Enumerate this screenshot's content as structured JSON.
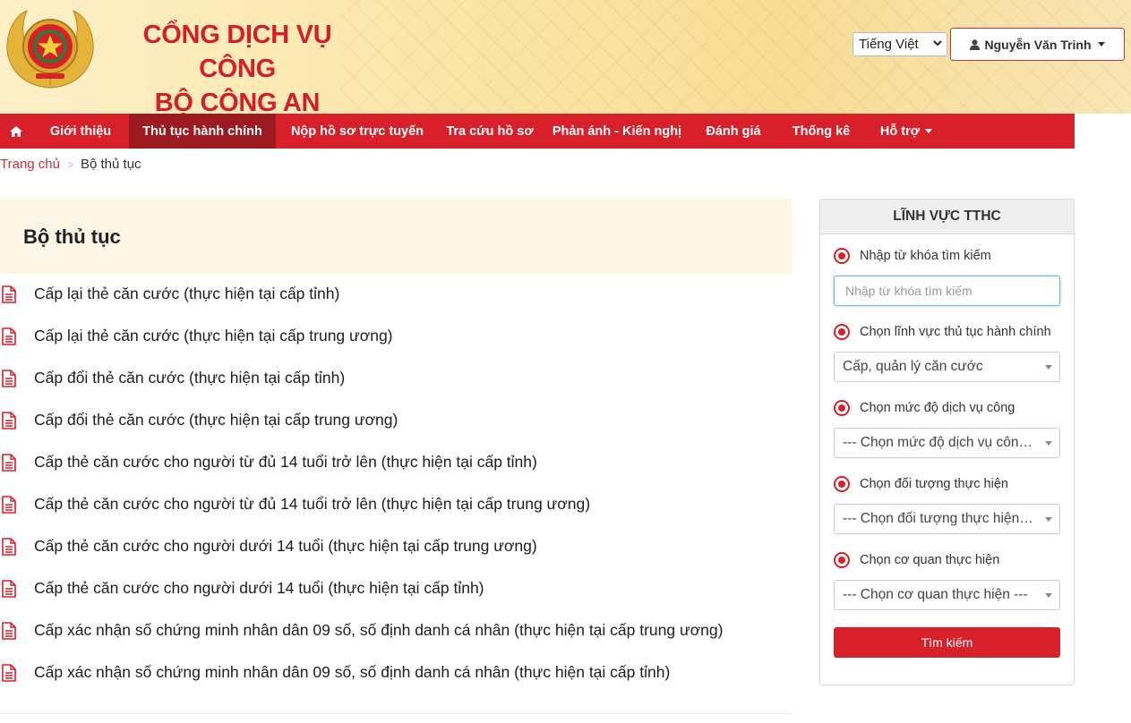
{
  "header": {
    "title_line1": "CỔNG DỊCH VỤ CÔNG",
    "title_line2": "BỘ CÔNG AN",
    "language_selected": "Tiếng Việt",
    "user_name": "Nguyễn Văn Trinh",
    "brand_red": "#d8202b"
  },
  "nav": {
    "items": [
      {
        "label": "Giới thiệu"
      },
      {
        "label": "Thủ tục hành chính"
      },
      {
        "label": "Nộp hồ sơ trực tuyến"
      },
      {
        "label": "Tra cứu hồ sơ"
      },
      {
        "label": "Phản ánh - Kiến nghị"
      },
      {
        "label": "Đánh giá"
      },
      {
        "label": "Thống kê"
      },
      {
        "label": "Hỗ trợ"
      }
    ],
    "active_index": 1
  },
  "breadcrumb": {
    "home": "Trang chủ",
    "separator": ">",
    "current": "Bộ thủ tục"
  },
  "main": {
    "title": "Bộ thủ tục",
    "procedures": [
      "Cấp lại thẻ căn cước (thực hiện tại cấp tỉnh)",
      "Cấp lại thẻ căn cước (thực hiện tại cấp trung ương)",
      "Cấp đổi thẻ căn cước (thực hiện tại cấp tỉnh)",
      "Cấp đổi thẻ căn cước (thực hiện tại cấp trung ương)",
      "Cấp thẻ căn cước cho người từ đủ 14 tuổi trở lên (thực hiện tại cấp tỉnh)",
      "Cấp thẻ căn cước cho người từ đủ 14 tuổi trở lên (thực hiện tại cấp trung ương)",
      "Cấp thẻ căn cước cho người dưới 14 tuổi (thực hiện tại cấp trung ương)",
      "Cấp thẻ căn cước cho người dưới 14 tuổi (thực hiện tại cấp tỉnh)",
      "Cấp xác nhận số chứng minh nhân dân 09 số, số định danh cá nhân (thực hiện tại cấp trung ương)",
      "Cấp xác nhận số chứng minh nhân dân 09 số, số định danh cá nhân (thực hiện tại cấp tỉnh)"
    ]
  },
  "sidebar": {
    "title": "LĨNH VỰC TTHC",
    "keyword_label": "Nhập từ khóa tìm kiếm",
    "keyword_placeholder": "Nhập từ khóa tìm kiếm",
    "field_label": "Chọn lĩnh vực thủ tục hành chính",
    "field_value": "Cấp, quản lý căn cước",
    "level_label": "Chọn mức độ dịch vụ công",
    "level_value": "--- Chọn mức độ dịch vụ công ---",
    "subject_label": "Chọn đối tượng thực hiện",
    "subject_value": "--- Chọn đối tượng thực hiện ---",
    "agency_label": "Chọn cơ quan thực hiện",
    "agency_value": "--- Chọn cơ quan thực hiện ---",
    "search_button": "Tìm kiếm"
  }
}
